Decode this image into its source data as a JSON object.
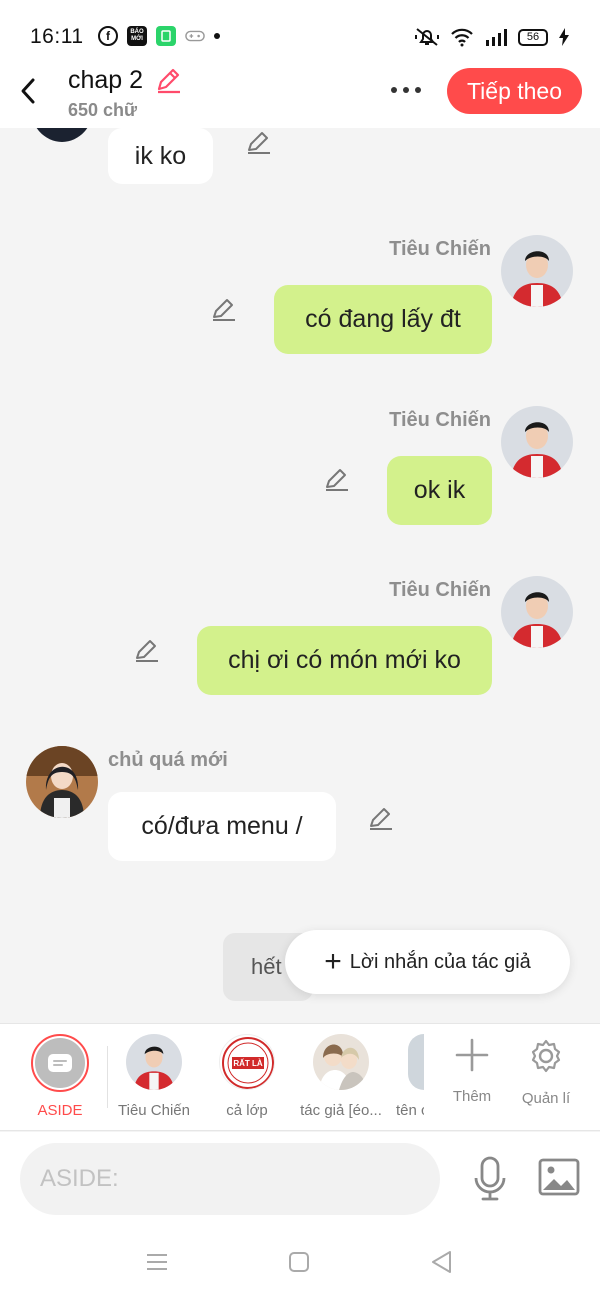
{
  "status_bar": {
    "time": "16:11",
    "apps": [
      "facebook-icon",
      "baomoi-icon",
      "app-icon"
    ],
    "baomoi_text": "BÁO MỚI",
    "battery": "56"
  },
  "header": {
    "title": "chap 2",
    "word_count": "650 chữ",
    "next_label": "Tiếp theo"
  },
  "messages": [
    {
      "side": "left",
      "name": "",
      "text": "ik ko"
    },
    {
      "side": "right",
      "name": "Tiêu Chiến",
      "text": "có đang lấy đt"
    },
    {
      "side": "right",
      "name": "Tiêu Chiến",
      "text": "ok ik"
    },
    {
      "side": "right",
      "name": "Tiêu Chiến",
      "text": "chị ơi có món mới ko"
    },
    {
      "side": "left",
      "name": "chủ quá mới",
      "text": "có/đưa menu /"
    },
    {
      "side": "left",
      "name": "",
      "text": "hết"
    }
  ],
  "author_note": {
    "label": "Lời nhắn của tác giả"
  },
  "characters": [
    {
      "label": "ASIDE"
    },
    {
      "label": "Tiêu Chiến"
    },
    {
      "label": "cả lớp",
      "badge_text": "RẤT LÀ"
    },
    {
      "label": "tác giả [éo..."
    },
    {
      "label": "tên c"
    }
  ],
  "tools": {
    "add_label": "Thêm",
    "manage_label": "Quản lí"
  },
  "input": {
    "placeholder": "ASIDE:"
  },
  "colors": {
    "accent": "#ff4b4b",
    "right_bubble": "#d3f18c",
    "left_bubble": "#ffffff",
    "background": "#f4f4f4"
  }
}
